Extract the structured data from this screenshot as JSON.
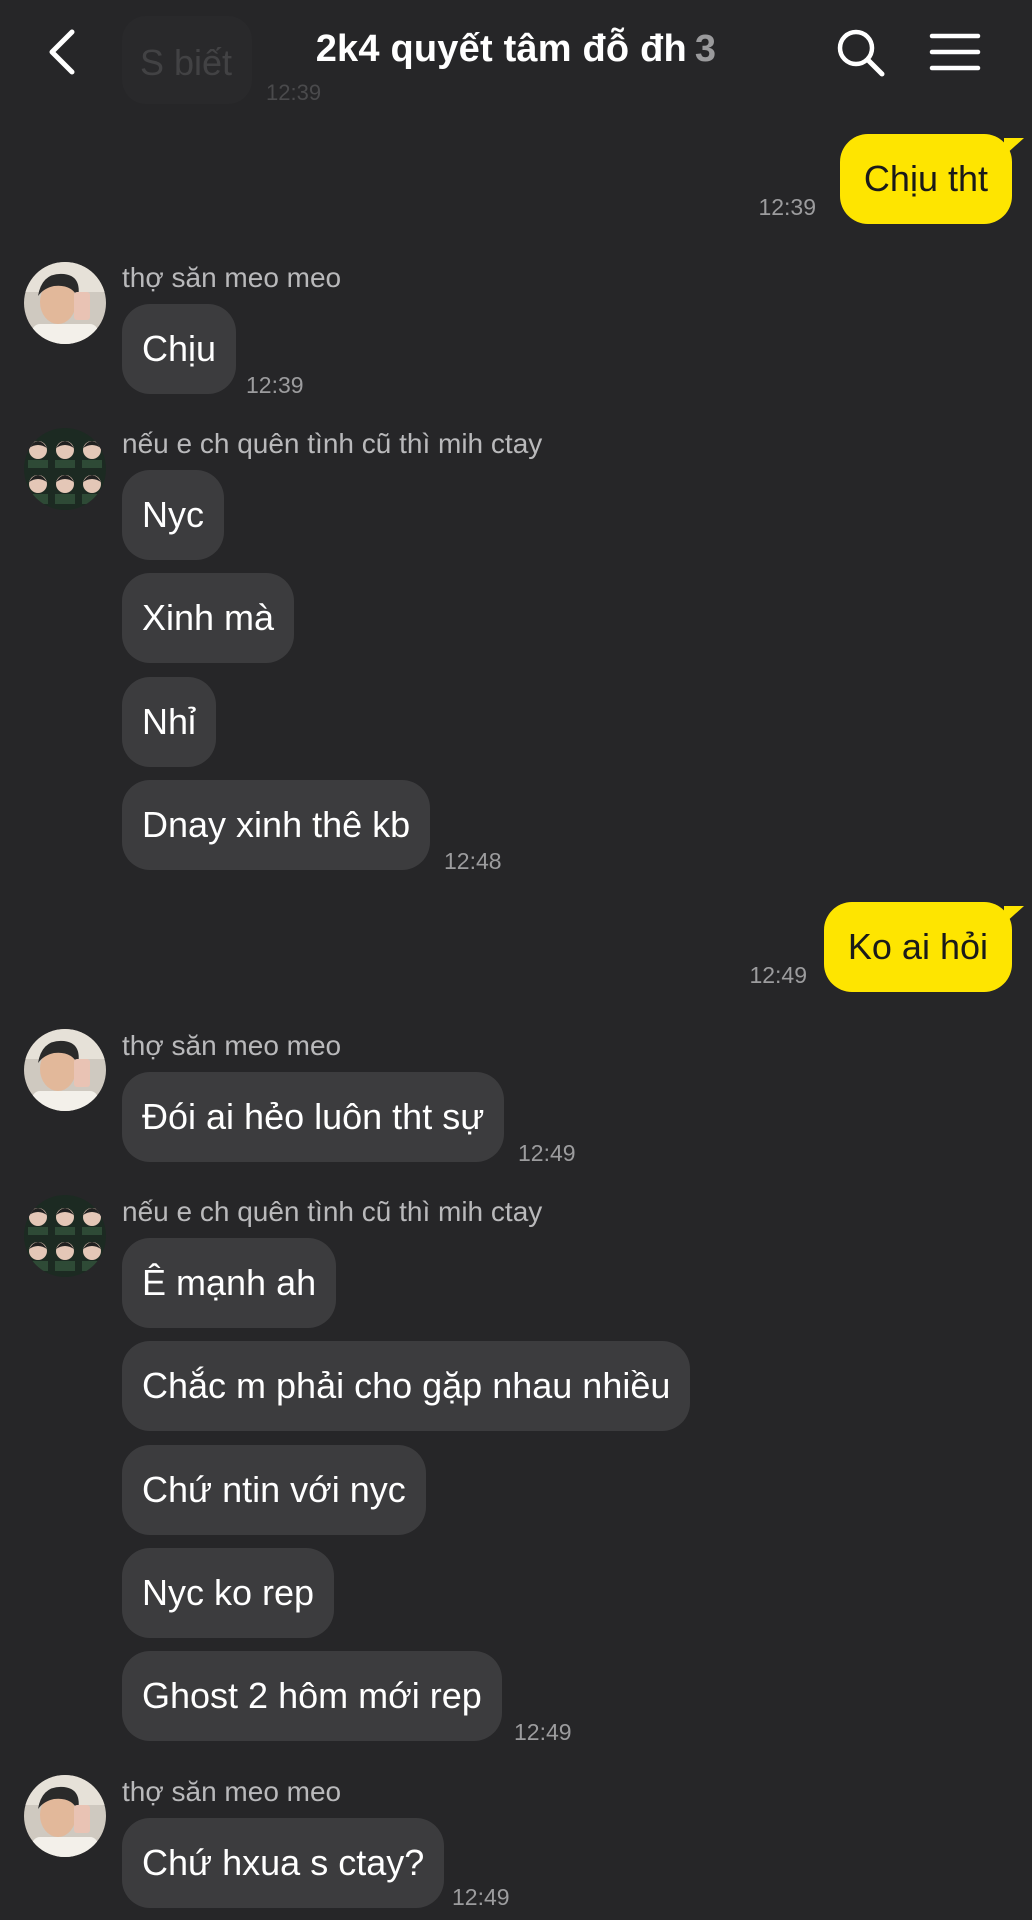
{
  "header": {
    "title": "2k4 quyết tâm đỗ đh",
    "member_count": "3",
    "back_icon": "chevron-left-icon",
    "search_icon": "search-icon",
    "menu_icon": "hamburger-menu-icon"
  },
  "previous_message": {
    "text": "S biết",
    "time": "12:39"
  },
  "colors": {
    "background": "#262628",
    "incoming_bubble": "#3c3c3e",
    "outgoing_bubble": "#fee500"
  },
  "messages": [
    {
      "type": "outgoing",
      "text": "Chịu tht",
      "time": "12:39"
    },
    {
      "type": "incoming_group",
      "sender": "thợ săn meo meo",
      "bubbles": [
        "Chịu"
      ],
      "time": "12:39"
    },
    {
      "type": "incoming_group",
      "sender": "nếu e ch quên tình cũ thì mih ctay",
      "bubbles": [
        "Nyc",
        "Xinh mà",
        "Nhỉ",
        "Dnay xinh thê kb"
      ],
      "time": "12:48"
    },
    {
      "type": "outgoing",
      "text": "Ko ai hỏi",
      "time": "12:49"
    },
    {
      "type": "incoming_group",
      "sender": "thợ săn meo meo",
      "bubbles": [
        "Đói ai hẻo luôn tht sự"
      ],
      "time": "12:49"
    },
    {
      "type": "incoming_group",
      "sender": "nếu e ch quên tình cũ thì mih ctay",
      "bubbles": [
        "Ê mạnh ah",
        "Chắc m phải cho gặp nhau nhiều",
        "Chứ ntin với nyc",
        "Nyc ko rep",
        "Ghost 2 hôm mới rep"
      ],
      "time": "12:49"
    },
    {
      "type": "incoming_group",
      "sender": "thợ săn meo meo",
      "bubbles": [
        "Chứ hxua s ctay?"
      ],
      "time": "12:49"
    }
  ]
}
